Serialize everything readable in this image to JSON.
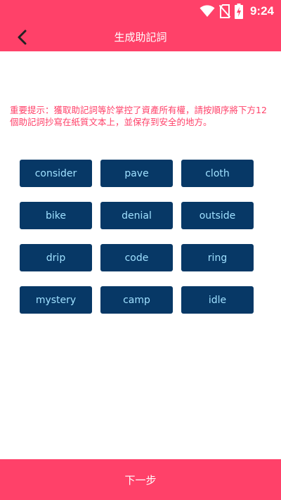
{
  "status_bar": {
    "time": "9:24",
    "icons": [
      "wifi-icon",
      "no-sim-icon",
      "battery-charging-icon"
    ]
  },
  "header": {
    "title": "生成助記詞",
    "back_icon": "chevron-left-icon"
  },
  "hint": {
    "text": "重要提示：獲取助記詞等於掌控了資產所有權，請按順序將下方12個助記詞抄寫在紙質文本上，並保存到安全的地方。"
  },
  "mnemonic": {
    "words": [
      "consider",
      "pave",
      "cloth",
      "bike",
      "denial",
      "outside",
      "drip",
      "code",
      "ring",
      "mystery",
      "camp",
      "idle"
    ]
  },
  "footer": {
    "next_label": "下一步"
  },
  "colors": {
    "accent": "#ff4169",
    "chip_bg": "#073866",
    "chip_text": "#9fe0ff",
    "hint_text": "#ff4169"
  }
}
